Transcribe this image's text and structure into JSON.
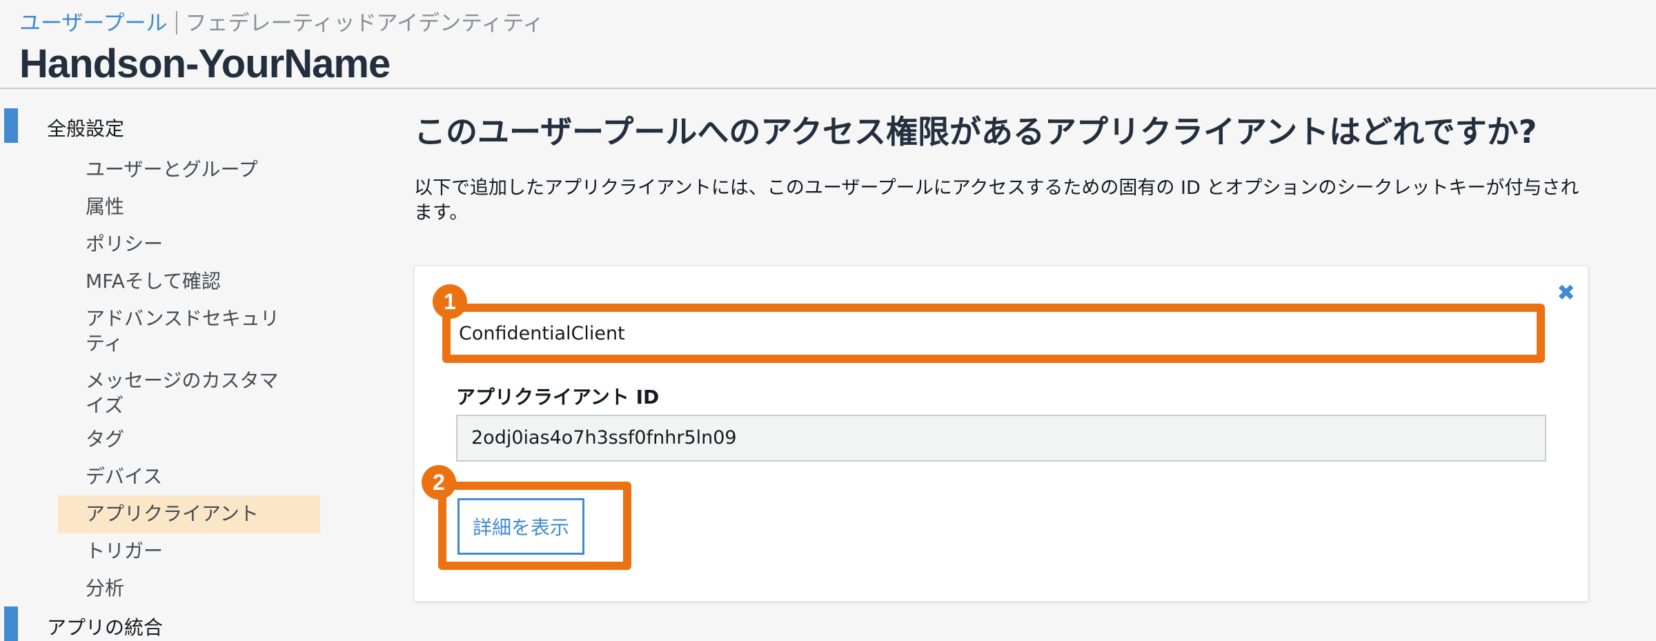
{
  "breadcrumb": {
    "link": "ユーザープール",
    "current": "フェデレーティッドアイデンティティ"
  },
  "app_title": "Handson-YourName",
  "sidebar": {
    "section_general": "全般設定",
    "items": [
      "ユーザーとグループ",
      "属性",
      "ポリシー",
      "MFAそして確認",
      "アドバンスドセキュリティ",
      "メッセージのカスタマイズ",
      "タグ",
      "デバイス",
      "アプリクライアント",
      "トリガー",
      "分析"
    ],
    "active_item": "アプリクライアント",
    "section_app": "アプリの統合"
  },
  "main": {
    "title": "このユーザープールへのアクセス権限があるアプリクライアントはどれですか?",
    "description": "以下で追加したアプリクライアントには、このユーザープールにアクセスするための固有の ID とオプションのシークレットキーが付与されます。"
  },
  "client_card": {
    "close_icon": "close-icon",
    "client_name": "ConfidentialClient",
    "client_id_label": "アプリクライアント ID",
    "client_id_value": "2odj0ias4o7h3ssf0fnhr5ln09",
    "details_button": "詳細を表示"
  },
  "annotations": {
    "badge_1": "1",
    "badge_2": "2"
  },
  "colors": {
    "highlight": "#ec7211",
    "accent_blue": "#3f8ad0",
    "active_nav_bg": "#fbe6c8"
  }
}
